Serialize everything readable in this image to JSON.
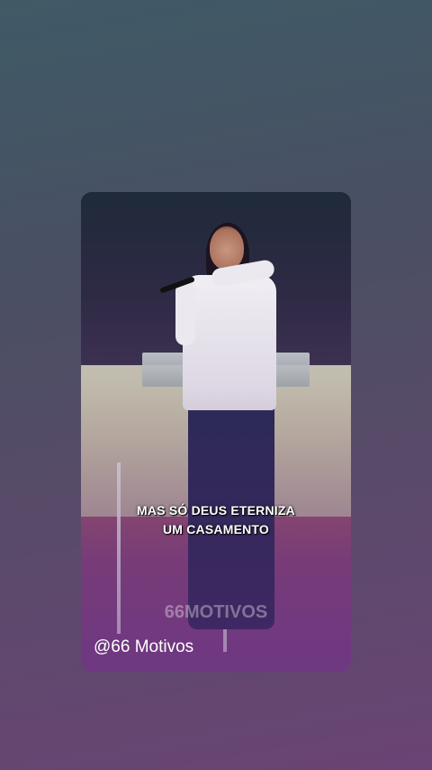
{
  "video": {
    "caption_line1": "MAS SÓ  DEUS ETERNIZA",
    "caption_line2": "UM CASAMENTO",
    "watermark": "66MOTIVOS"
  },
  "author": {
    "handle": "@66 Motivos"
  }
}
